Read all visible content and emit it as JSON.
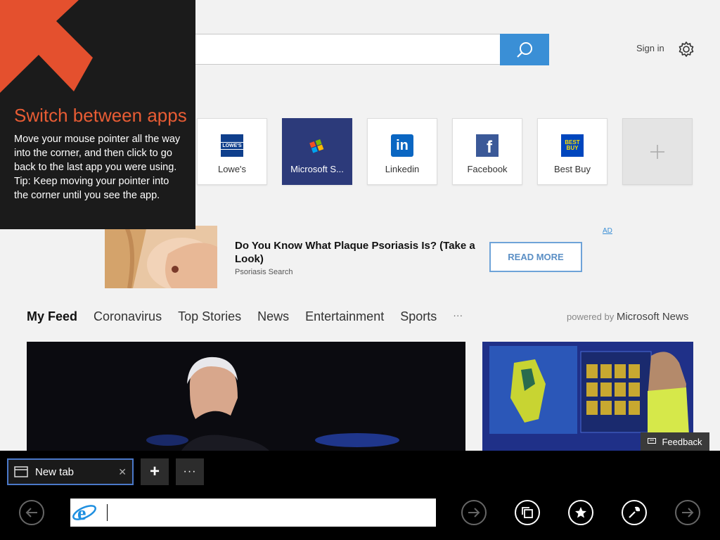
{
  "header": {
    "search_placeholder": "",
    "sign_in": "Sign in"
  },
  "tiles": [
    {
      "label": "Lowe's",
      "icon": "lowes-logo-icon",
      "brand_color": "#0f3f8c"
    },
    {
      "label": "Microsoft S...",
      "icon": "microsoft-store-icon",
      "brand_color": "#2c3a7a"
    },
    {
      "label": "Linkedin",
      "icon": "linkedin-icon",
      "brand_color": "#0a66c2"
    },
    {
      "label": "Facebook",
      "icon": "facebook-icon",
      "brand_color": "#3b5998"
    },
    {
      "label": "Best Buy",
      "icon": "bestbuy-icon",
      "brand_color": "#0046be"
    }
  ],
  "ad": {
    "title": "Do You Know What Plaque Psoriasis Is? (Take a Look)",
    "source": "Psoriasis Search",
    "button": "READ MORE",
    "choice": "AD"
  },
  "feed": {
    "tabs": [
      "My Feed",
      "Coronavirus",
      "Top Stories",
      "News",
      "Entertainment",
      "Sports",
      "···"
    ],
    "powered_by": "powered by",
    "powered_brand": "Microsoft News"
  },
  "feedback": "Feedback",
  "tip": {
    "title": "Switch between apps",
    "body": "Move your mouse pointer all the way into the corner, and then click to go back to the last app you were using.",
    "hint": "Tip: Keep moving your pointer into the corner until you see the app."
  },
  "bottom": {
    "tab_label": "New tab",
    "tab_close": "✕",
    "new_tab": "+",
    "more": "···",
    "address_value": ""
  },
  "colors": {
    "accent_blue": "#3a8fd6",
    "tip_orange": "#e85c34"
  }
}
